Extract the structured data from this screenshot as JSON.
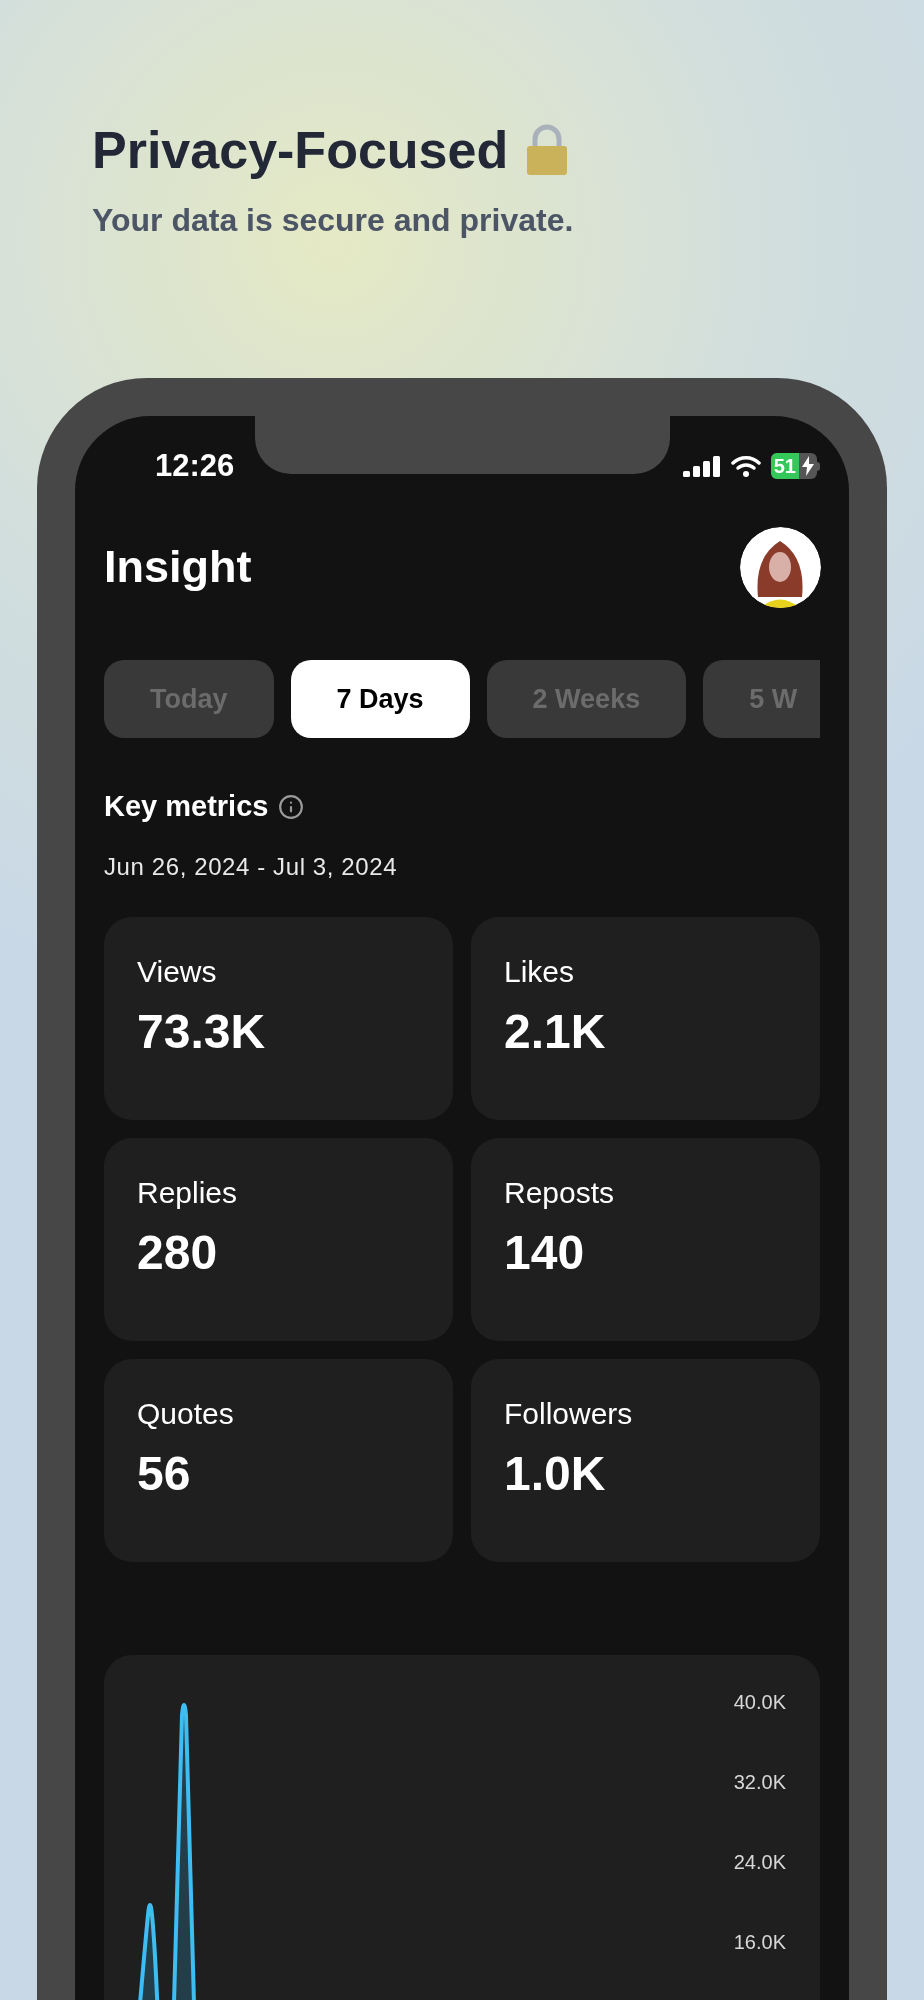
{
  "header": {
    "title": "Privacy-Focused",
    "subtitle": "Your data is secure and private."
  },
  "status_bar": {
    "time": "12:26",
    "battery": "51",
    "charging": true
  },
  "app": {
    "title": "Insight"
  },
  "tabs": [
    {
      "label": "Today",
      "selected": false
    },
    {
      "label": "7 Days",
      "selected": true
    },
    {
      "label": "2 Weeks",
      "selected": false
    },
    {
      "label": "5 W",
      "selected": false
    }
  ],
  "section": {
    "title": "Key metrics",
    "date_range": "Jun 26, 2024 - Jul 3, 2024"
  },
  "metrics": [
    {
      "label": "Views",
      "value": "73.3K"
    },
    {
      "label": "Likes",
      "value": "2.1K"
    },
    {
      "label": "Replies",
      "value": "280"
    },
    {
      "label": "Reposts",
      "value": "140"
    },
    {
      "label": "Quotes",
      "value": "56"
    },
    {
      "label": "Followers",
      "value": "1.0K"
    }
  ],
  "chart": {
    "y_labels": [
      "40.0K",
      "32.0K",
      "24.0K",
      "16.0K"
    ]
  }
}
